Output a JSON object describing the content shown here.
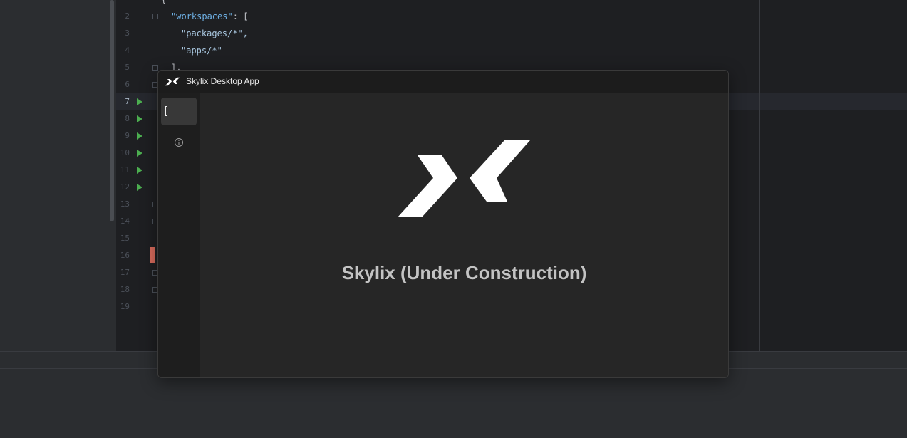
{
  "ide": {
    "line_numbers": [
      "2",
      "3",
      "4",
      "5",
      "6",
      "7",
      "8",
      "9",
      "10",
      "11",
      "12",
      "13",
      "14",
      "15",
      "16",
      "17",
      "18",
      "19"
    ],
    "active_line": "7",
    "code": {
      "line1": "{",
      "line2_key": "\"workspaces\"",
      "line2_rest": ": [",
      "line3": "\"packages/*\",",
      "line4": "\"apps/*\"",
      "line5": "],"
    }
  },
  "app": {
    "window_title": "Skylix Desktop App",
    "hero_title": "Skylix (Under Construction)",
    "icons": {
      "titlebar_logo": "skylix-logo-icon",
      "sidebar_home": "cursor-icon",
      "sidebar_info": "info-icon",
      "hero_logo": "skylix-logo-icon"
    },
    "colors": {
      "window_bg": "#262626",
      "titlebar_bg": "#1c1c1c",
      "sidebar_bg": "#1e1e1e",
      "logo": "#ffffff",
      "hero_text": "#c3c3c3",
      "run_green": "#4caf50",
      "change_marker": "#d96b5c"
    }
  }
}
